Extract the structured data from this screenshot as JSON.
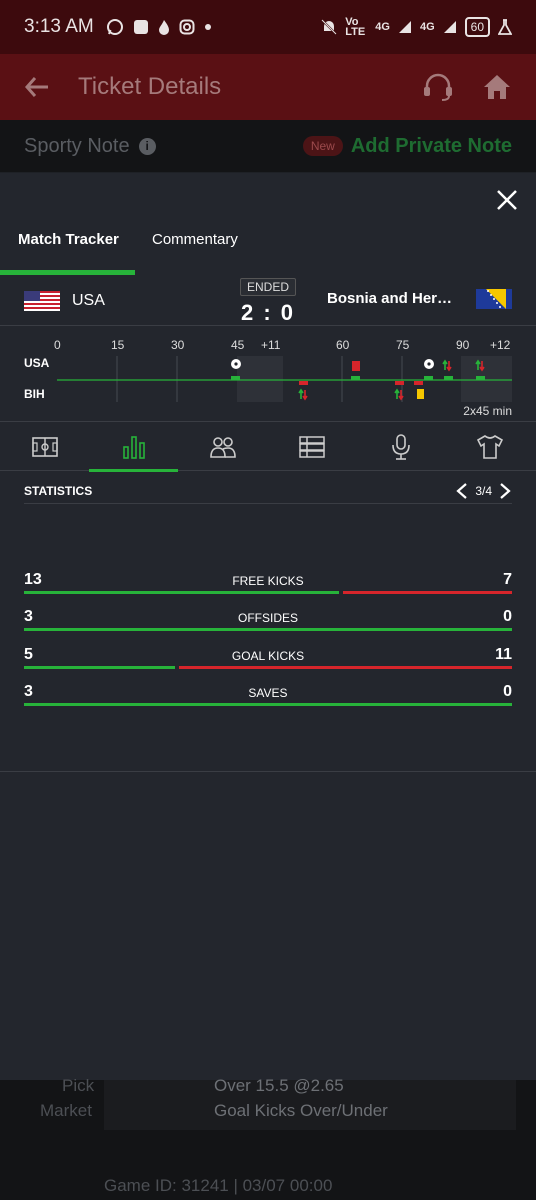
{
  "status_bar": {
    "time": "3:13 AM",
    "network_1": "Vo LTE",
    "network_2": "4G",
    "network_3": "4G",
    "battery": "60"
  },
  "app_bar": {
    "title": "Ticket Details",
    "back_icon": "arrow-left-icon",
    "support_icon": "headset-icon",
    "home_icon": "home-icon"
  },
  "note_row": {
    "label": "Sporty Note",
    "badge": "New",
    "action": "Add Private Note"
  },
  "tracker": {
    "tabs": [
      "Match Tracker",
      "Commentary"
    ],
    "home_team": "USA",
    "away_team": "Bosnia and Herzegovina",
    "away_team_display": "Bosnia and Herze...",
    "status": "ENDED",
    "score": "2 : 0",
    "timeline": {
      "ticks": [
        "0",
        "15",
        "30",
        "45",
        "+11",
        "60",
        "75",
        "90",
        "+12"
      ],
      "home_label": "USA",
      "away_label": "BIH",
      "duration": "2x45 min"
    },
    "icon_tabs": [
      "pitch-icon",
      "bar-chart-icon",
      "players-icon",
      "lineup-icon",
      "microphone-icon",
      "jersey-icon"
    ],
    "stats_title": "STATISTICS",
    "pager": "3/4",
    "stats": [
      {
        "name": "FREE KICKS",
        "home": "13",
        "away": "7",
        "home_share": 0.65
      },
      {
        "name": "OFFSIDES",
        "home": "3",
        "away": "0",
        "home_share": 1.0
      },
      {
        "name": "GOAL KICKS",
        "home": "5",
        "away": "11",
        "home_share": 0.3125
      },
      {
        "name": "SAVES",
        "home": "3",
        "away": "0",
        "home_share": 1.0
      }
    ]
  },
  "pick": {
    "pick_label": "Pick",
    "pick_value": "Over 15.5 @2.65",
    "market_label": "Market",
    "market_value": "Goal Kicks Over/Under",
    "game_id": "Game ID: 31241 | 03/07 00:00"
  },
  "colors": {
    "accent_green": "#27b33a",
    "red": "#d6252b",
    "header_red": "#5a1014"
  }
}
